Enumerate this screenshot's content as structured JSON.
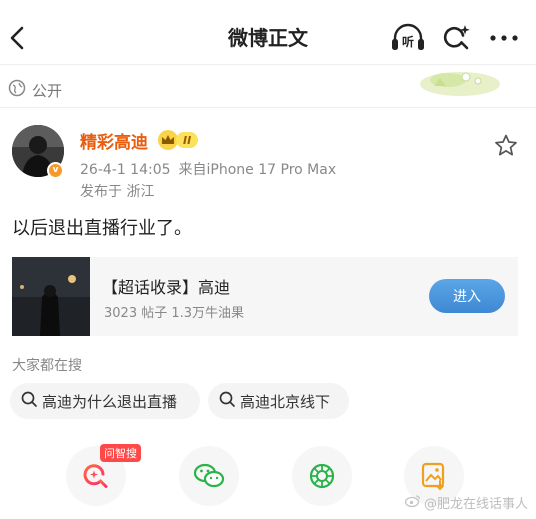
{
  "nav": {
    "title": "微博正文",
    "back_icon": "chevron-left-icon",
    "listen_icon": "headphones-listen-icon",
    "listen_glyph": "听",
    "search_icon": "ai-search-icon",
    "more_icon": "more-dots-icon"
  },
  "visibility": {
    "icon": "globe-icon",
    "label": "公开"
  },
  "post": {
    "author": "精彩高迪",
    "vip_level": "II",
    "verified_badge": "v",
    "time": "26-4-1 14:05",
    "source": "来自iPhone 17 Pro Max",
    "location": "发布于 浙江",
    "text": "以后退出直播行业了。"
  },
  "supertopic": {
    "title": "【超话收录】高迪",
    "stats": "3023 帖子 1.3万牛油果",
    "join_label": "进入"
  },
  "hot_search": {
    "title": "大家都在搜",
    "items": [
      "高迪为什么退出直播",
      "高迪北京线下"
    ]
  },
  "share": {
    "ask_badge": "问智搜",
    "icons": [
      "ai-search-share-icon",
      "wechat-icon",
      "moments-icon",
      "save-image-icon"
    ]
  },
  "watermark": "@肥龙在线话事人",
  "colors": {
    "author": "#ea5d0c",
    "join_button": "#4a93dc",
    "badge_red": "#ff4848",
    "vip_yellow": "#fde15b"
  }
}
